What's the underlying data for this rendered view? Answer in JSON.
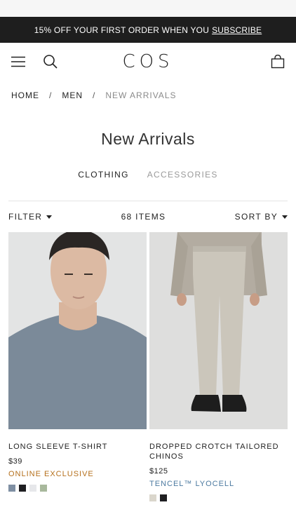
{
  "promo": {
    "text": "15% OFF YOUR FIRST ORDER WHEN YOU",
    "link": "SUBSCRIBE"
  },
  "header": {
    "logo": "COS",
    "icons": [
      "menu-icon",
      "search-icon",
      "bag-icon"
    ]
  },
  "breadcrumb": {
    "items": [
      "HOME",
      "MEN",
      "NEW ARRIVALS"
    ],
    "separator": "/"
  },
  "page": {
    "title": "New Arrivals"
  },
  "tabs": [
    {
      "label": "CLOTHING",
      "active": true
    },
    {
      "label": "ACCESSORIES",
      "active": false
    }
  ],
  "toolbar": {
    "filter": "FILTER",
    "count": "68 ITEMS",
    "sort": "SORT BY"
  },
  "products": [
    {
      "name": "LONG SLEEVE T-SHIRT",
      "price": "$39",
      "tag": "ONLINE EXCLUSIVE",
      "tag_color": "#b5701c",
      "swatches": [
        "#7f8fa3",
        "#1f1f22",
        "#e6e7ea",
        "#a8b89c"
      ]
    },
    {
      "name": "DROPPED CROTCH TAILORED CHINOS",
      "price": "$125",
      "tag": "TENCEL™ LYOCELL",
      "tag_color": "#4c7aa0",
      "swatches": [
        "#dad6cc",
        "#1f1f22"
      ]
    }
  ]
}
